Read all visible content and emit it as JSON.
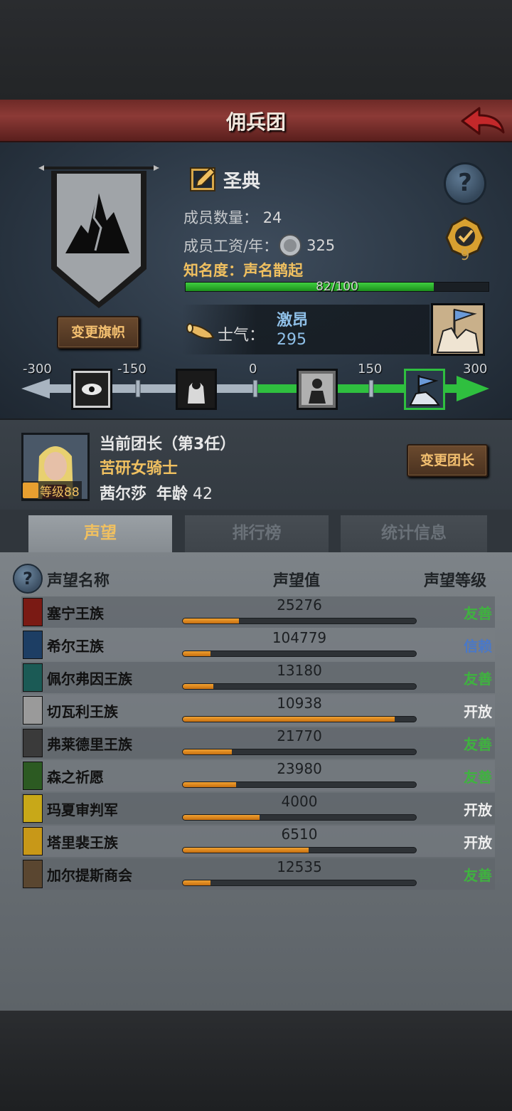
{
  "header": {
    "title": "佣兵团"
  },
  "company": {
    "name": "圣典",
    "members_label": "成员数量：",
    "members": "24",
    "wage_label": "成员工资/年：",
    "wage": "325",
    "fame_label": "知名度：",
    "fame_state": "声名鹊起",
    "fame_progress": "82/100",
    "fame_fraction": 0.82,
    "rank_badge": "9",
    "change_banner_label": "变更旗帜",
    "help_glyph": "?"
  },
  "morale": {
    "label": "士气：",
    "state": "激昂",
    "value": "295",
    "scale": [
      "-300",
      "-150",
      "0",
      "150",
      "300"
    ]
  },
  "leader": {
    "title": "当前团长（第3任）",
    "class": "苦研女骑士",
    "name": "茜尔莎",
    "age_label": "年龄",
    "age": "42",
    "level": "等级88",
    "change_label": "变更团长"
  },
  "tabs": [
    {
      "label": "声望"
    },
    {
      "label": "排行榜"
    },
    {
      "label": "统计信息"
    }
  ],
  "table": {
    "headers": {
      "name": "声望名称",
      "value": "声望值",
      "level": "声望等级"
    },
    "rows": [
      {
        "name": "塞宁王族",
        "value": "25276",
        "fill": 0.24,
        "level": "友善",
        "level_color": "#3fb33f",
        "crest_color": "#7a1a14"
      },
      {
        "name": "希尔王族",
        "value": "104779",
        "fill": 0.12,
        "level": "信赖",
        "level_color": "#4a78c8",
        "crest_color": "#1d3e64"
      },
      {
        "name": "佩尔弗因王族",
        "value": "13180",
        "fill": 0.13,
        "level": "友善",
        "level_color": "#3fb33f",
        "crest_color": "#1b5a55"
      },
      {
        "name": "切瓦利王族",
        "value": "10938",
        "fill": 0.91,
        "level": "开放",
        "level_color": "#eeeeee",
        "crest_color": "#9a9a9a"
      },
      {
        "name": "弗莱德里王族",
        "value": "21770",
        "fill": 0.21,
        "level": "友善",
        "level_color": "#3fb33f",
        "crest_color": "#3a3a3a"
      },
      {
        "name": "森之祈愿",
        "value": "23980",
        "fill": 0.23,
        "level": "友善",
        "level_color": "#3fb33f",
        "crest_color": "#2c5a22"
      },
      {
        "name": "玛夏审判军",
        "value": "4000",
        "fill": 0.33,
        "level": "开放",
        "level_color": "#eeeeee",
        "crest_color": "#c8a818"
      },
      {
        "name": "塔里裴王族",
        "value": "6510",
        "fill": 0.54,
        "level": "开放",
        "level_color": "#eeeeee",
        "crest_color": "#c89818"
      },
      {
        "name": "加尔提斯商会",
        "value": "12535",
        "fill": 0.12,
        "level": "友善",
        "level_color": "#3fb33f",
        "crest_color": "#5a4630"
      }
    ]
  }
}
